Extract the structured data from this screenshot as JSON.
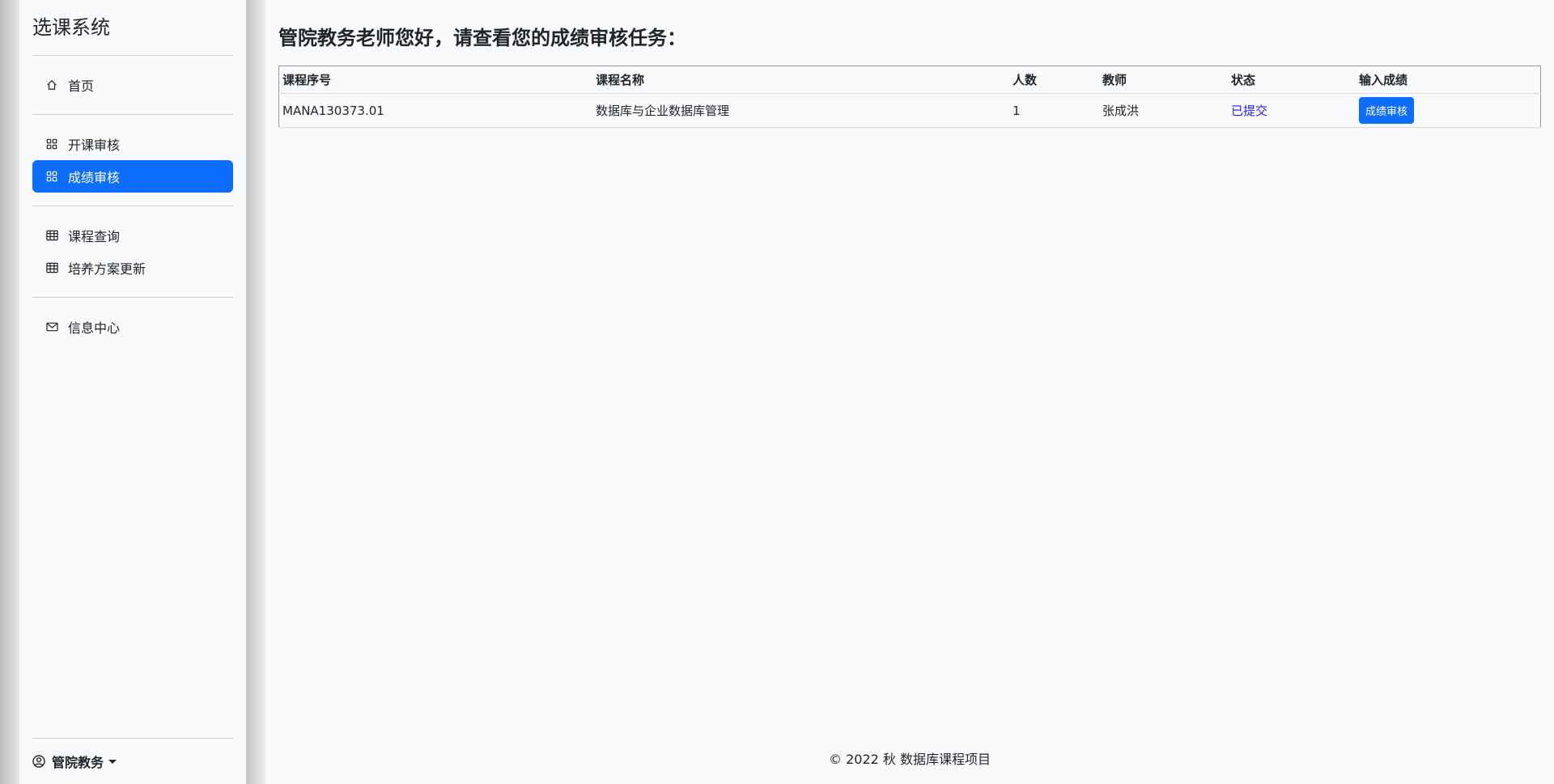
{
  "sidebar": {
    "brand": "选课系统",
    "groups": [
      {
        "items": [
          {
            "label": "首页",
            "icon": "home-icon"
          }
        ]
      },
      {
        "items": [
          {
            "label": "开课审核",
            "icon": "grid-icon"
          },
          {
            "label": "成绩审核",
            "icon": "grid-icon",
            "active": true
          }
        ]
      },
      {
        "items": [
          {
            "label": "课程查询",
            "icon": "table-icon"
          },
          {
            "label": "培养方案更新",
            "icon": "table-icon"
          }
        ]
      },
      {
        "items": [
          {
            "label": "信息中心",
            "icon": "envelope-icon"
          }
        ]
      }
    ],
    "user": {
      "label": "管院教务",
      "icon": "user-circle-icon"
    }
  },
  "main": {
    "title": "管院教务老师您好，请查看您的成绩审核任务：",
    "table": {
      "headers": [
        "课程序号",
        "课程名称",
        "人数",
        "教师",
        "状态",
        "输入成绩"
      ],
      "rows": [
        {
          "course_id": "MANA130373.01",
          "course_name": "数据库与企业数据库管理",
          "count": "1",
          "teacher": "张成洪",
          "status": "已提交",
          "action": "成绩审核"
        }
      ]
    }
  },
  "footer": {
    "text": "© 2022 秋 数据库课程项目"
  },
  "colors": {
    "accent": "#0d6efd",
    "status_submitted": "#2222ee"
  }
}
